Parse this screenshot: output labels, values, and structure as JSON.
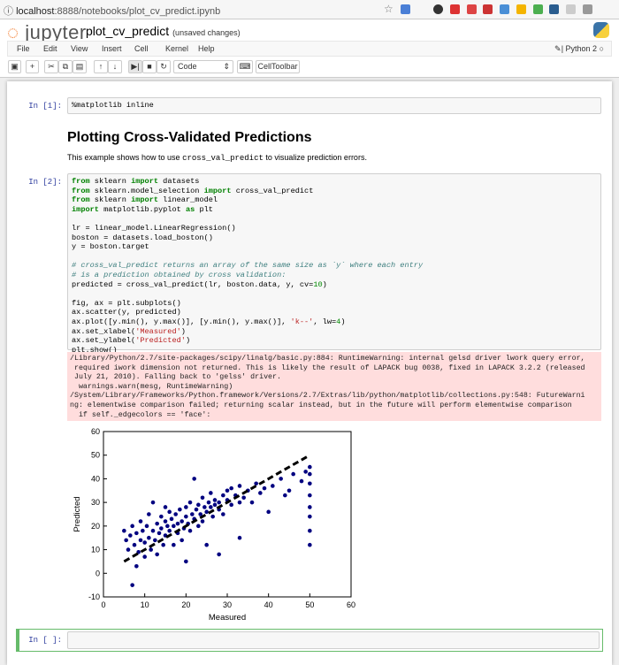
{
  "browser": {
    "url_host": "localhost",
    "url_rest": ":8888/notebooks/plot_cv_predict.ipynb"
  },
  "header": {
    "logo": "jupyter",
    "notebook_name": "plot_cv_predict",
    "status": "(unsaved changes)",
    "kernel": "Python 2"
  },
  "menu": [
    "File",
    "Edit",
    "View",
    "Insert",
    "Cell",
    "Kernel",
    "Help"
  ],
  "toolbar": {
    "cell_type": "Code",
    "celltoolbar": "CellToolbar"
  },
  "cells": {
    "c1": {
      "prompt": "In [1]:",
      "code": "%matplotlib inline"
    },
    "md": {
      "title": "Plotting Cross-Validated Predictions",
      "text_before": "This example shows how to use ",
      "code": "cross_val_predict",
      "text_after": " to visualize prediction errors."
    },
    "c2": {
      "prompt": "In [2]:"
    },
    "stderr": "/Library/Python/2.7/site-packages/scipy/linalg/basic.py:884: RuntimeWarning: internal gelsd driver lwork query error,\n required iwork dimension not returned. This is likely the result of LAPACK bug 0038, fixed in LAPACK 3.2.2 (released\n July 21, 2010). Falling back to 'gelss' driver.\n  warnings.warn(mesg, RuntimeWarning)\n/System/Library/Frameworks/Python.framework/Versions/2.7/Extras/lib/python/matplotlib/collections.py:548: FutureWarni\nng: elementwise comparison failed; returning scalar instead, but in the future will perform elementwise comparison\n  if self._edgecolors == 'face':",
    "c3": {
      "prompt": "In [ ]:"
    }
  },
  "chart_data": {
    "type": "scatter",
    "xlabel": "Measured",
    "ylabel": "Predicted",
    "xlim": [
      0,
      60
    ],
    "ylim": [
      -10,
      60
    ],
    "xticks": [
      0,
      10,
      20,
      30,
      40,
      50,
      60
    ],
    "yticks": [
      -10,
      0,
      10,
      20,
      30,
      40,
      50,
      60
    ],
    "reference_line": {
      "x": [
        5,
        50
      ],
      "y": [
        5,
        50
      ],
      "style": "k--"
    },
    "point_color": "#000080",
    "points": [
      [
        5,
        18
      ],
      [
        5.5,
        14
      ],
      [
        6,
        10
      ],
      [
        6.5,
        16
      ],
      [
        7,
        -5
      ],
      [
        7,
        20
      ],
      [
        7.5,
        12
      ],
      [
        8,
        3
      ],
      [
        8,
        17
      ],
      [
        8.5,
        9
      ],
      [
        9,
        14
      ],
      [
        9,
        22
      ],
      [
        9.5,
        18
      ],
      [
        10,
        7
      ],
      [
        10,
        13
      ],
      [
        10.5,
        20
      ],
      [
        11,
        15
      ],
      [
        11,
        25
      ],
      [
        11.5,
        10
      ],
      [
        12,
        18
      ],
      [
        12,
        30
      ],
      [
        12.5,
        14
      ],
      [
        13,
        21
      ],
      [
        13,
        8
      ],
      [
        13.5,
        17
      ],
      [
        14,
        19
      ],
      [
        14,
        24
      ],
      [
        14.5,
        12
      ],
      [
        15,
        16
      ],
      [
        15,
        22
      ],
      [
        15.5,
        20
      ],
      [
        16,
        18
      ],
      [
        16,
        26
      ],
      [
        16.5,
        23
      ],
      [
        17,
        12
      ],
      [
        17,
        20
      ],
      [
        17.5,
        25
      ],
      [
        18,
        21
      ],
      [
        18,
        17
      ],
      [
        18.5,
        27
      ],
      [
        19,
        22
      ],
      [
        19,
        14
      ],
      [
        19.5,
        19
      ],
      [
        20,
        24
      ],
      [
        20,
        28
      ],
      [
        20.5,
        21
      ],
      [
        21,
        18
      ],
      [
        21,
        30
      ],
      [
        21.5,
        25
      ],
      [
        22,
        23
      ],
      [
        22,
        40
      ],
      [
        22.5,
        27
      ],
      [
        23,
        20
      ],
      [
        23,
        29
      ],
      [
        23.5,
        25
      ],
      [
        24,
        22
      ],
      [
        24,
        32
      ],
      [
        24.5,
        28
      ],
      [
        25,
        26
      ],
      [
        25,
        12
      ],
      [
        25.5,
        30
      ],
      [
        26,
        28
      ],
      [
        26,
        34
      ],
      [
        26.5,
        24
      ],
      [
        27,
        29
      ],
      [
        27,
        31
      ],
      [
        28,
        30
      ],
      [
        28,
        27
      ],
      [
        29,
        33
      ],
      [
        29,
        25
      ],
      [
        30,
        31
      ],
      [
        30,
        35
      ],
      [
        31,
        29
      ],
      [
        31,
        36
      ],
      [
        32,
        33
      ],
      [
        33,
        30
      ],
      [
        33,
        37
      ],
      [
        34,
        32
      ],
      [
        35,
        35
      ],
      [
        36,
        30
      ],
      [
        37,
        38
      ],
      [
        38,
        34
      ],
      [
        39,
        36
      ],
      [
        41,
        37
      ],
      [
        43,
        40
      ],
      [
        44,
        33
      ],
      [
        45,
        35
      ],
      [
        46,
        42
      ],
      [
        48,
        39
      ],
      [
        50,
        45
      ],
      [
        50,
        42
      ],
      [
        50,
        38
      ],
      [
        50,
        33
      ],
      [
        50,
        28
      ],
      [
        50,
        24
      ],
      [
        50,
        18
      ],
      [
        50,
        12
      ],
      [
        49,
        43
      ],
      [
        15,
        28
      ],
      [
        20,
        5
      ],
      [
        28,
        8
      ],
      [
        33,
        15
      ],
      [
        40,
        26
      ]
    ]
  }
}
